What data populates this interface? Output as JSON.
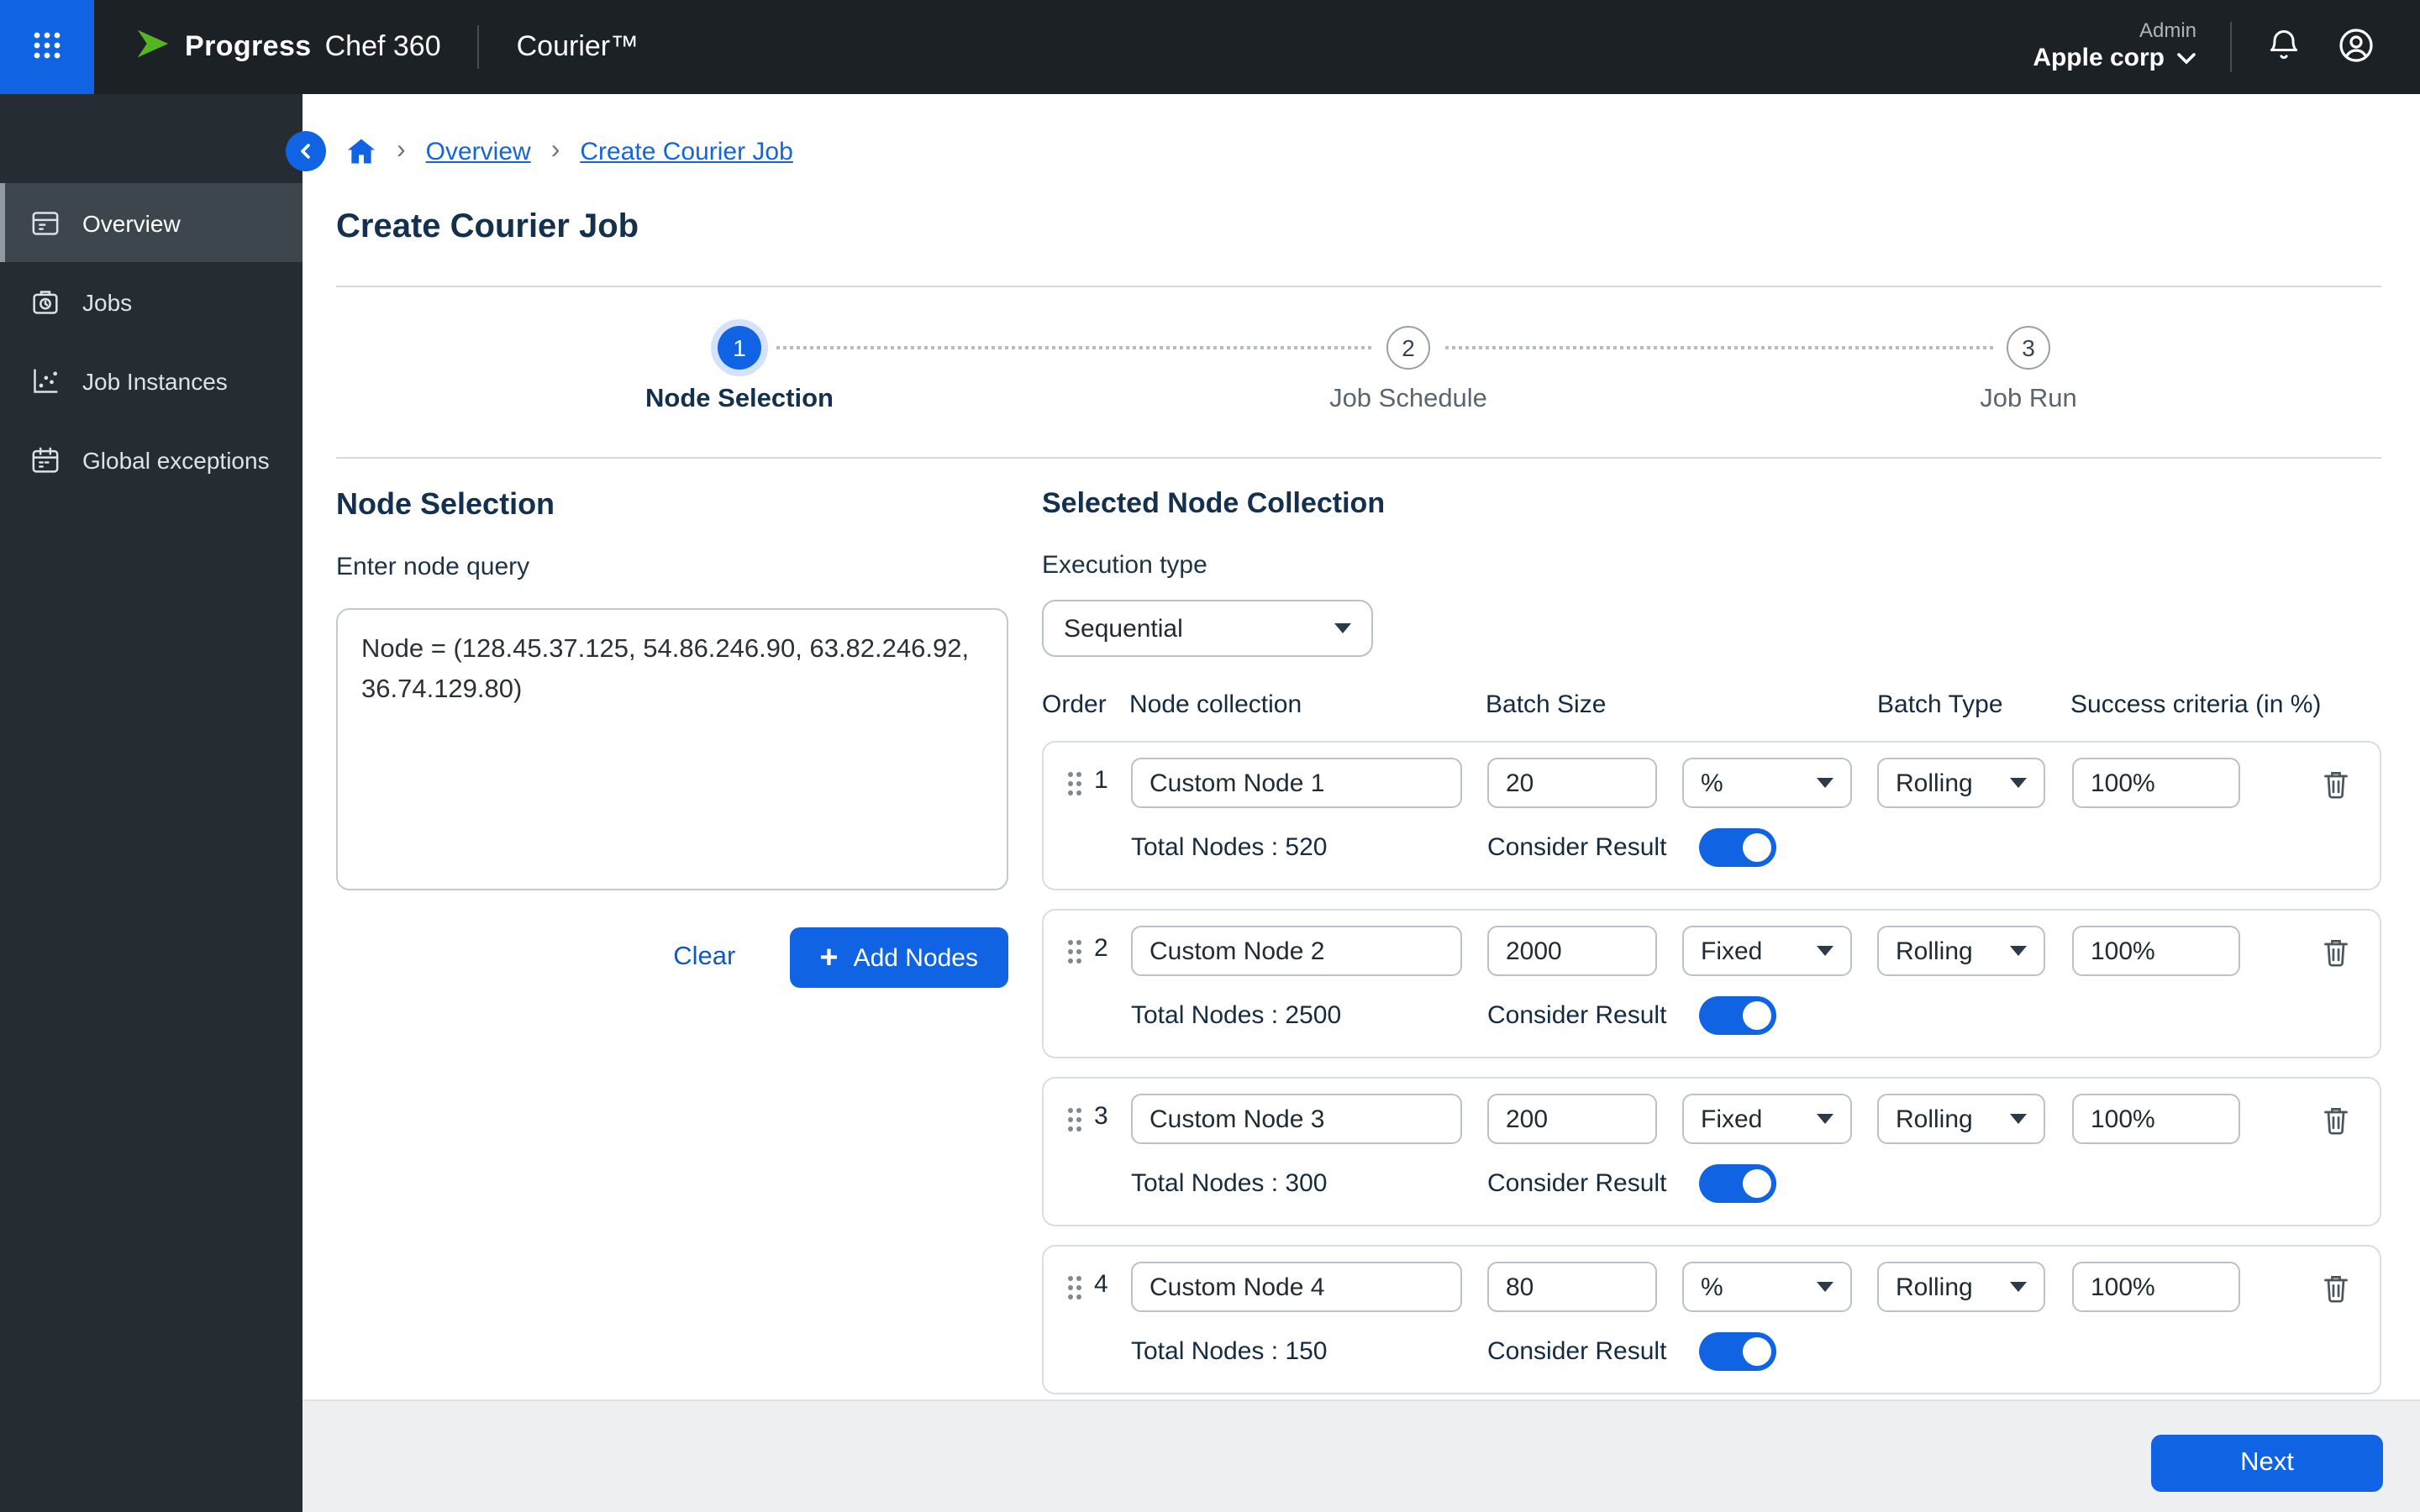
{
  "colors": {
    "accent": "#1064E3",
    "topbar_bg": "#1B2125",
    "sidebar_bg": "#252D32",
    "heading": "#13304F",
    "toggle_on": "#1064E3"
  },
  "topbar": {
    "brand_name": "Progress",
    "brand_suite": "Chef 360",
    "product": "Courier™",
    "user_role": "Admin",
    "user_org": "Apple corp"
  },
  "sidebar": {
    "items": [
      {
        "id": "overview",
        "label": "Overview",
        "active": true
      },
      {
        "id": "jobs",
        "label": "Jobs",
        "active": false
      },
      {
        "id": "job-instances",
        "label": "Job Instances",
        "active": false
      },
      {
        "id": "global-exceptions",
        "label": "Global exceptions",
        "active": false
      }
    ]
  },
  "breadcrumb": {
    "separator": "›",
    "links": [
      "Overview",
      "Create Courier Job"
    ]
  },
  "page_title": "Create Courier Job",
  "stepper": {
    "steps": [
      {
        "num": "1",
        "label": "Node Selection",
        "active": true
      },
      {
        "num": "2",
        "label": "Job Schedule",
        "active": false
      },
      {
        "num": "3",
        "label": "Job Run",
        "active": false
      }
    ]
  },
  "node_query": {
    "heading": "Node Selection",
    "label": "Enter node query",
    "value": "Node = (128.45.37.125, 54.86.246.90, 63.82.246.92, 36.74.129.80)",
    "clear_label": "Clear",
    "plus": "+",
    "add_button_label": "Add Nodes"
  },
  "collection": {
    "heading": "Selected Node Collection",
    "execution_label": "Execution type",
    "execution_value": "Sequential",
    "columns": [
      "Order",
      "Node collection",
      "Batch Size",
      "Batch Type",
      "Success criteria (in %)"
    ],
    "total_nodes_label": "Total Nodes :",
    "consider_result_label": "Consider Result",
    "rows": [
      {
        "order": "1",
        "name": "Custom Node 1",
        "batch_size": "20",
        "batch_unit": "%",
        "batch_type": "Rolling",
        "success": "100%",
        "total_nodes": "520",
        "consider_result": true
      },
      {
        "order": "2",
        "name": "Custom Node 2",
        "batch_size": "2000",
        "batch_unit": "Fixed",
        "batch_type": "Rolling",
        "success": "100%",
        "total_nodes": "2500",
        "consider_result": true
      },
      {
        "order": "3",
        "name": "Custom Node 3",
        "batch_size": "200",
        "batch_unit": "Fixed",
        "batch_type": "Rolling",
        "success": "100%",
        "total_nodes": "300",
        "consider_result": true
      },
      {
        "order": "4",
        "name": "Custom Node 4",
        "batch_size": "80",
        "batch_unit": "%",
        "batch_type": "Rolling",
        "success": "100%",
        "total_nodes": "150",
        "consider_result": true
      }
    ]
  },
  "footer": {
    "next_label": "Next"
  }
}
